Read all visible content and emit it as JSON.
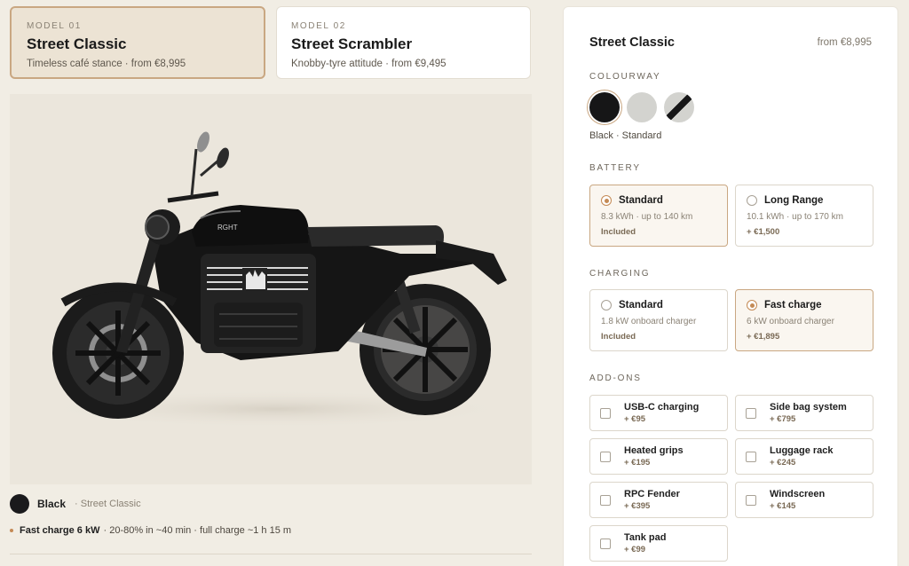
{
  "models": [
    {
      "kicker": "MODEL 01",
      "name": "Street Classic",
      "sub": "Timeless café stance · from €8,995",
      "selected": true
    },
    {
      "kicker": "MODEL 02",
      "name": "Street Scrambler",
      "sub": "Knobby-tyre attitude · from €9,495",
      "selected": false
    }
  ],
  "preview": {
    "image_alt": "motorcycle-image",
    "tank_badge": "RGHT",
    "colour_name": "Black",
    "model_name": "· Street Classic",
    "charge_bold": "Fast charge 6 kW",
    "charge_detail": "· 20-80% in ~40 min · full charge ~1 h 15 m"
  },
  "panel": {
    "title": "Street Classic",
    "price": "from €8,995",
    "colourway_label": "COLOURWAY",
    "colourways": [
      {
        "name": "black",
        "selected": true
      },
      {
        "name": "silver",
        "selected": false
      },
      {
        "name": "silver-black-stripe",
        "selected": false
      }
    ],
    "colourway_caption": "Black · Standard",
    "battery_label": "BATTERY",
    "battery": [
      {
        "name": "Standard",
        "desc": "8.3 kWh · up to 140 km",
        "price": "Included",
        "selected": true
      },
      {
        "name": "Long Range",
        "desc": "10.1 kWh · up to 170 km",
        "price": "+ €1,500",
        "selected": false
      }
    ],
    "charging_label": "CHARGING",
    "charging": [
      {
        "name": "Standard",
        "desc": "1.8 kW onboard charger",
        "price": "Included",
        "selected": false
      },
      {
        "name": "Fast charge",
        "desc": "6 kW onboard charger",
        "price": "+ €1,895",
        "selected": true
      }
    ],
    "addons_label": "ADD-ONS",
    "addons": [
      {
        "name": "USB-C charging",
        "price": "+ €95"
      },
      {
        "name": "Side bag system",
        "price": "+ €795"
      },
      {
        "name": "Heated grips",
        "price": "+ €195"
      },
      {
        "name": "Luggage rack",
        "price": "+ €245"
      },
      {
        "name": "RPC Fender",
        "price": "+ €395"
      },
      {
        "name": "Windscreen",
        "price": "+ €145"
      },
      {
        "name": "Tank pad",
        "price": "+ €99"
      }
    ]
  },
  "colors": {
    "accent": "#c48a55",
    "selected_border": "#c9a782",
    "background": "#f1ede4"
  }
}
